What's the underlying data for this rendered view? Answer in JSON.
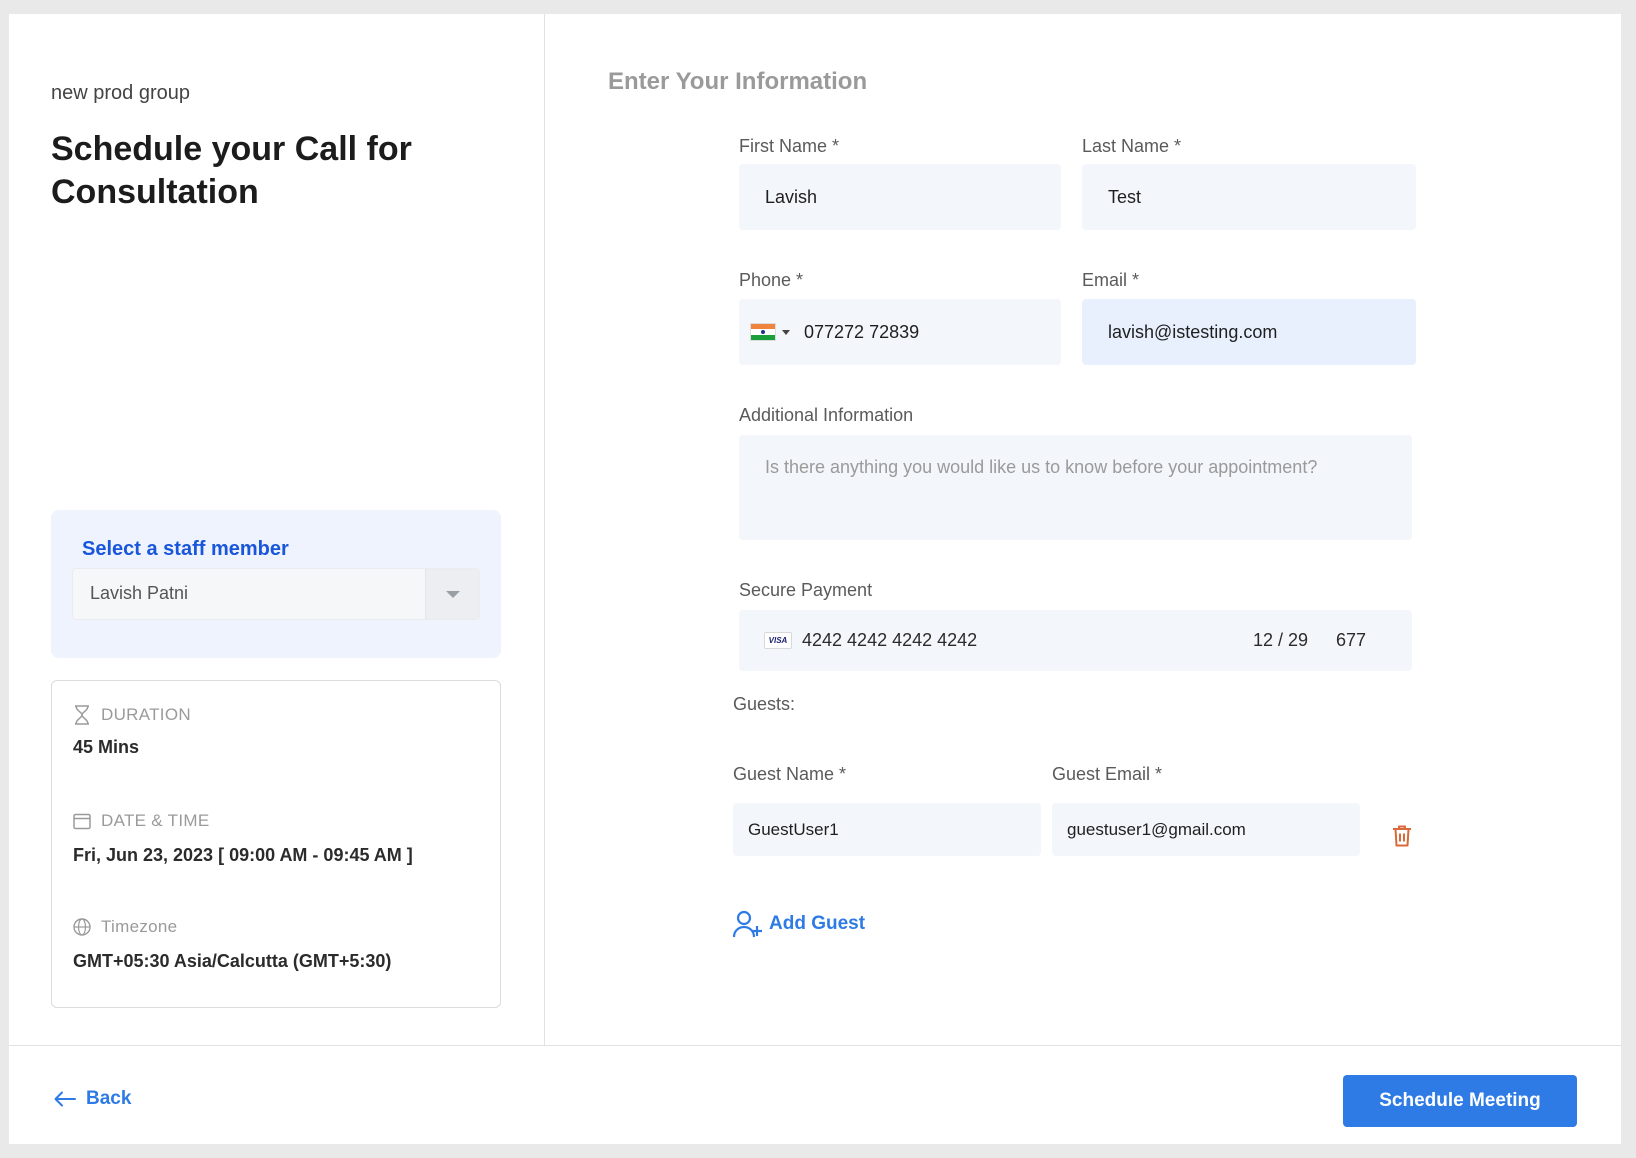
{
  "sidebar": {
    "group_name": "new prod group",
    "title": "Schedule your Call for Consultation",
    "staff": {
      "label": "Select a staff member",
      "selected": "Lavish Patni"
    },
    "details": {
      "duration_label": "DURATION",
      "duration_value": "45 Mins",
      "datetime_label": "DATE & TIME",
      "datetime_value": "Fri, Jun 23, 2023 [ 09:00 AM - 09:45 AM ]",
      "timezone_label": "Timezone",
      "timezone_value": "GMT+05:30 Asia/Calcutta (GMT+5:30)"
    }
  },
  "form": {
    "section_title": "Enter Your Information",
    "first_name": {
      "label": "First Name *",
      "value": "Lavish"
    },
    "last_name": {
      "label": "Last Name *",
      "value": "Test"
    },
    "phone": {
      "label": "Phone *",
      "value": "077272 72839",
      "country_flag": "india-flag"
    },
    "email": {
      "label": "Email *",
      "value": "lavish@istesting.com"
    },
    "additional_info": {
      "label": "Additional Information",
      "placeholder": "Is there anything you would like us to know before your appointment?"
    },
    "payment": {
      "label": "Secure Payment",
      "card_brand": "VISA",
      "card_number": "4242 4242 4242 4242",
      "expiry": "12 / 29",
      "cvc": "677"
    },
    "guests": {
      "label": "Guests:",
      "name_label": "Guest Name *",
      "email_label": "Guest Email *",
      "items": [
        {
          "name": "GuestUser1",
          "email": "guestuser1@gmail.com"
        }
      ],
      "add_label": "Add Guest"
    }
  },
  "footer": {
    "back_label": "Back",
    "submit_label": "Schedule Meeting"
  },
  "colors": {
    "accent": "#2f7be5",
    "staff_label": "#1a56db",
    "delete": "#d9683a",
    "input_bg": "#f3f6fa"
  }
}
